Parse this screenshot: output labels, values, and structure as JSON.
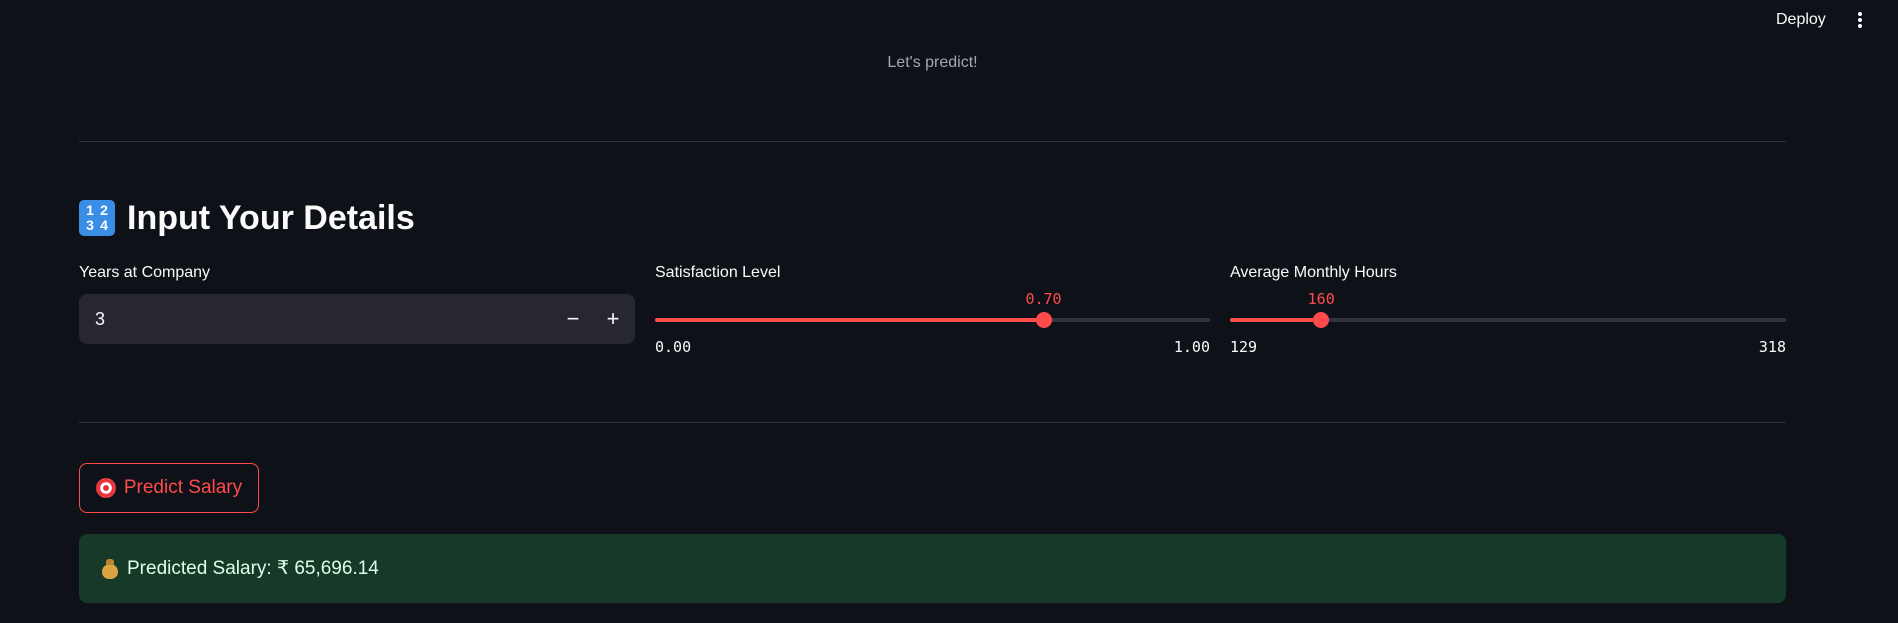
{
  "header": {
    "deploy_label": "Deploy",
    "menu_icon": "kebab-menu-icon"
  },
  "subtitle": "Let's predict!",
  "section": {
    "title": "Input Your Details",
    "icon": "input-numbers-icon",
    "icon_digits": [
      "1",
      "2",
      "3",
      "4"
    ]
  },
  "years_input": {
    "label": "Years at Company",
    "value": "3",
    "minus_label": "−",
    "plus_label": "+"
  },
  "satisfaction_slider": {
    "label": "Satisfaction Level",
    "value": 0.7,
    "value_text": "0.70",
    "min": 0,
    "max": 1,
    "min_text": "0.00",
    "max_text": "1.00"
  },
  "hours_slider": {
    "label": "Average Monthly Hours",
    "value": 160,
    "value_text": "160",
    "min": 129,
    "max": 318,
    "min_text": "129",
    "max_text": "318"
  },
  "predict_button": {
    "label": "Predict Salary",
    "icon": "target-icon"
  },
  "result": {
    "text": "Predicted Salary: ₹ 65,696.14",
    "icon": "moneybag-icon"
  },
  "colors": {
    "background": "#0e1117",
    "accent": "#ff4b4b",
    "success_bg": "#173928",
    "input_bg": "#262730"
  }
}
